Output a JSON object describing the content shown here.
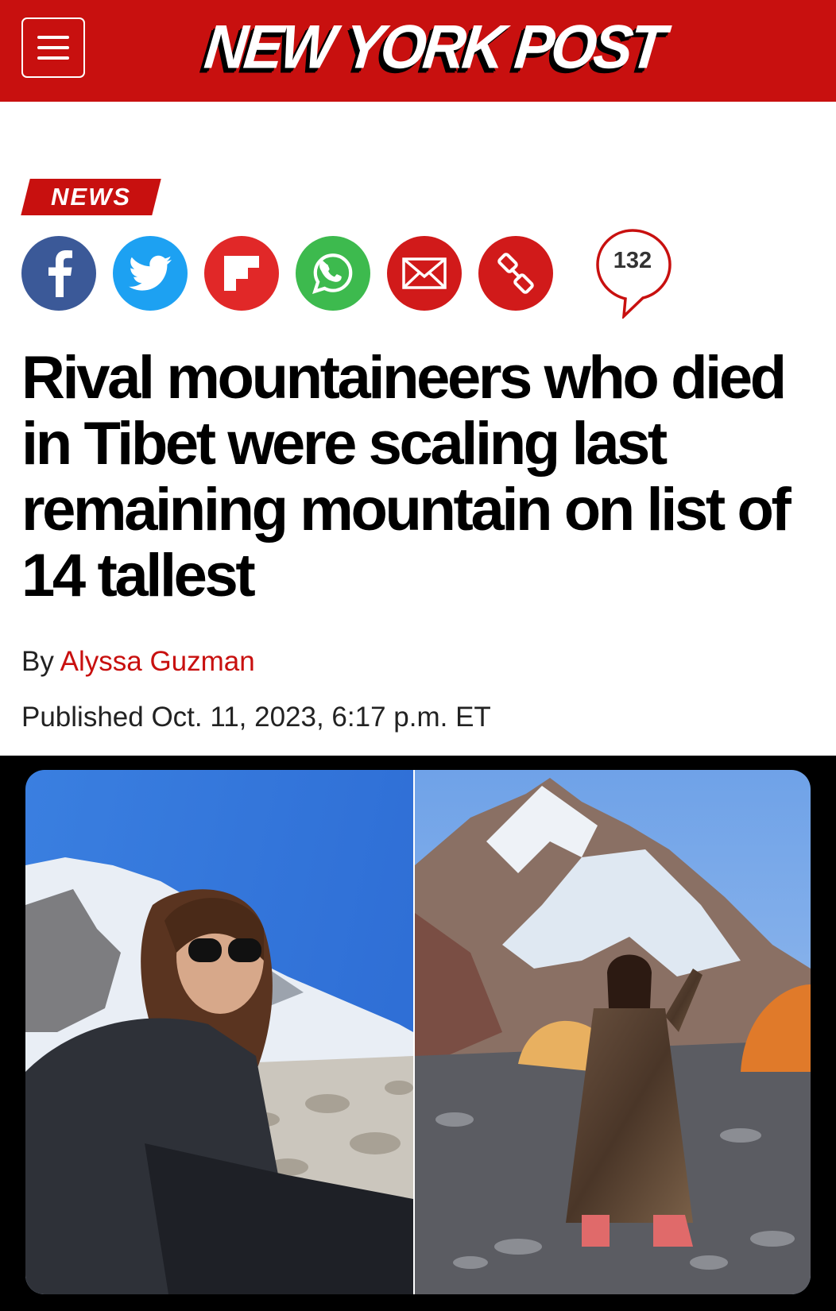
{
  "header": {
    "brand": "NEW YORK POST",
    "brand_color": "#c8100f"
  },
  "article": {
    "section": "NEWS",
    "share": {
      "icons": [
        "facebook-icon",
        "twitter-icon",
        "flipboard-icon",
        "whatsapp-icon",
        "email-icon",
        "link-icon"
      ],
      "comment_count": "132"
    },
    "headline": "Rival mountaineers who died in Tibet were scaling last remaining mountain on list of 14 tallest",
    "byline_prefix": "By ",
    "author": "Alyssa Guzman",
    "published": "Published Oct. 11, 2023, 6:17 p.m. ET"
  },
  "colors": {
    "facebook": "#3b5998",
    "twitter": "#1da1f2",
    "flipboard": "#e12828",
    "whatsapp": "#3dba4e",
    "email": "#d11a1a",
    "link": "#d11a1a"
  }
}
